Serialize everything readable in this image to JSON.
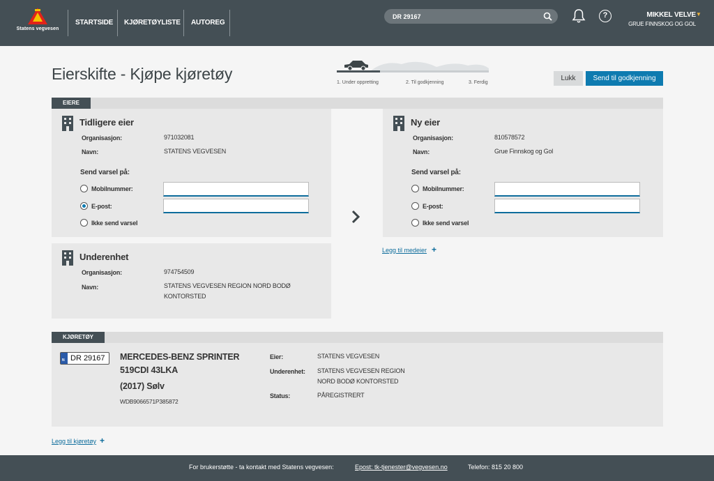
{
  "header": {
    "logo_text": "Statens vegvesen",
    "nav": [
      "STARTSIDE",
      "KJØRETØYLISTE",
      "AUTOREG"
    ],
    "search_value": "DR 29167",
    "user_name": "MIKKEL VELVE",
    "user_org": "GRUE FINNSKOG OG GOL",
    "icons": {
      "search": "search-icon",
      "bell": "bell-icon",
      "help": "help-icon"
    }
  },
  "page": {
    "title": "Eierskifte - Kjøpe kjøretøy",
    "steps": [
      "1. Under oppretting",
      "2. Til godkjenning",
      "3. Ferdig"
    ],
    "close_label": "Lukk",
    "send_label": "Send til godkjenning"
  },
  "owners": {
    "section_label": "EIERE",
    "previous": {
      "title": "Tidligere eier",
      "org_label": "Organisasjon:",
      "org_value": "971032081",
      "name_label": "Navn:",
      "name_value": "STATENS VEGVESEN",
      "notify_label": "Send varsel på:",
      "opt_mobile": "Mobilnummer:",
      "opt_email": "E-post:",
      "opt_none": "Ikke send varsel",
      "selected": "email"
    },
    "new": {
      "title": "Ny eier",
      "org_label": "Organisasjon:",
      "org_value": "810578572",
      "name_label": "Navn:",
      "name_value": "Grue Finnskog og Gol",
      "notify_label": "Send varsel på:",
      "opt_mobile": "Mobilnummer:",
      "opt_email": "E-post:",
      "opt_none": "Ikke send varsel",
      "selected": "none"
    },
    "subunit": {
      "title": "Underenhet",
      "org_label": "Organisasjon:",
      "org_value": "974754509",
      "name_label": "Navn:",
      "name_value_1": "STATENS VEGVESEN REGION NORD BODØ",
      "name_value_2": "KONTORSTED"
    },
    "add_coowner": "Legg til medeier"
  },
  "vehicle": {
    "section_label": "KJØRETØY",
    "plate": "DR 29167",
    "plate_country": "N",
    "model_line1": "MERCEDES-BENZ SPRINTER",
    "model_line2": "519CDI 43LKA",
    "year_color": "(2017) Sølv",
    "vin": "WDB9066571P385872",
    "owner_label": "Eier:",
    "owner_value": "STATENS VEGVESEN",
    "subunit_label": "Underenhet:",
    "subunit_value_1": "STATENS VEGVESEN REGION",
    "subunit_value_2": "NORD BODØ KONTORSTED",
    "status_label": "Status:",
    "status_value": "PÅREGISTRERT",
    "add_vehicle": "Legg til kjøretøy"
  },
  "footer": {
    "support": "For brukerstøtte - ta kontakt med Statens vegvesen:",
    "email": "Epost: tk-tjenester@vegvesen.no",
    "phone": "Telefon: 815 20 800"
  }
}
